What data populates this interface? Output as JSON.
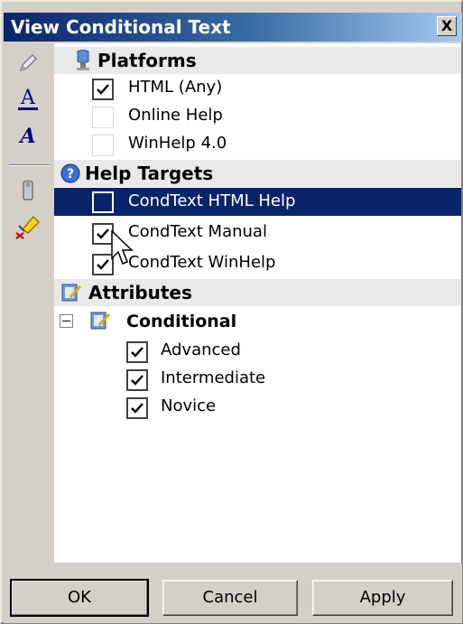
{
  "window": {
    "title": "View Conditional Text",
    "close_label": "X"
  },
  "toolbar": {
    "icons": [
      "pencil-icon",
      "text-underline-icon",
      "text-italic-icon",
      "clip-icon",
      "eraser-icon"
    ]
  },
  "tree": {
    "platforms": {
      "label": "Platforms",
      "items": [
        {
          "label": "HTML (Any)",
          "checked": true,
          "enabled": true
        },
        {
          "label": "Online Help",
          "checked": false,
          "enabled": false
        },
        {
          "label": "WinHelp 4.0",
          "checked": false,
          "enabled": false
        }
      ]
    },
    "help_targets": {
      "label": "Help Targets",
      "items": [
        {
          "label": "CondText HTML Help",
          "checked": false,
          "selected": true
        },
        {
          "label": "CondText Manual",
          "checked": true
        },
        {
          "label": "CondText WinHelp",
          "checked": true
        }
      ]
    },
    "attributes": {
      "label": "Attributes",
      "conditional": {
        "label": "Conditional",
        "expanded": true,
        "items": [
          {
            "label": "Advanced",
            "checked": true
          },
          {
            "label": "Intermediate",
            "checked": true
          },
          {
            "label": "Novice",
            "checked": true
          }
        ]
      }
    }
  },
  "buttons": {
    "ok": "OK",
    "cancel": "Cancel",
    "apply": "Apply"
  },
  "colors": {
    "selection": "#0a246a",
    "title_gradient_start": "#0a246a",
    "title_gradient_end": "#a6caf0",
    "dialog_face": "#d4d0c8"
  }
}
